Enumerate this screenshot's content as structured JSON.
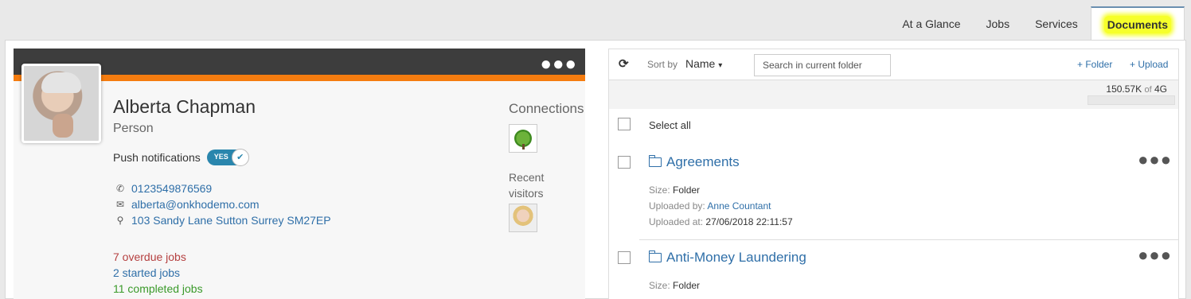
{
  "tabs": [
    {
      "label": "At a Glance"
    },
    {
      "label": "Jobs"
    },
    {
      "label": "Services"
    },
    {
      "label": "Documents",
      "active": true
    }
  ],
  "profile": {
    "menu_icon": "ellipsis-icon",
    "name": "Alberta Chapman",
    "type": "Person",
    "push_label": "Push notifications",
    "push_toggle": "YES",
    "phone": "0123549876569",
    "email": "alberta@onkhodemo.com",
    "address": "103 Sandy Lane Sutton Surrey SM27EP",
    "overdue": "7 overdue jobs",
    "started": "2 started jobs",
    "completed": "11 completed jobs",
    "connections_label": "Connections",
    "recent_visitors_line1": "Recent",
    "recent_visitors_line2": "visitors"
  },
  "documents": {
    "sort_label": "Sort by",
    "sort_value": "Name",
    "search_placeholder": "Search in current folder",
    "add_folder": "+ Folder",
    "add_upload": "+ Upload",
    "storage_used": "150.57K",
    "storage_of": "of",
    "storage_total": "4G",
    "storage_fraction": 0.0,
    "select_all": "Select all",
    "folders": [
      {
        "name": "Agreements",
        "size_label": "Size:",
        "size": "Folder",
        "uploaded_by_label": "Uploaded by:",
        "uploaded_by": "Anne Countant",
        "uploaded_at_label": "Uploaded at:",
        "uploaded_at": "27/06/2018 22:11:57"
      },
      {
        "name": "Anti-Money Laundering",
        "size_label": "Size:",
        "size": "Folder"
      }
    ]
  },
  "colors": {
    "accent": "#2f6fa8",
    "header_bar": "#3d3d3d",
    "orange_bar": "#f57c0f",
    "highlight": "#f6ff2a"
  }
}
